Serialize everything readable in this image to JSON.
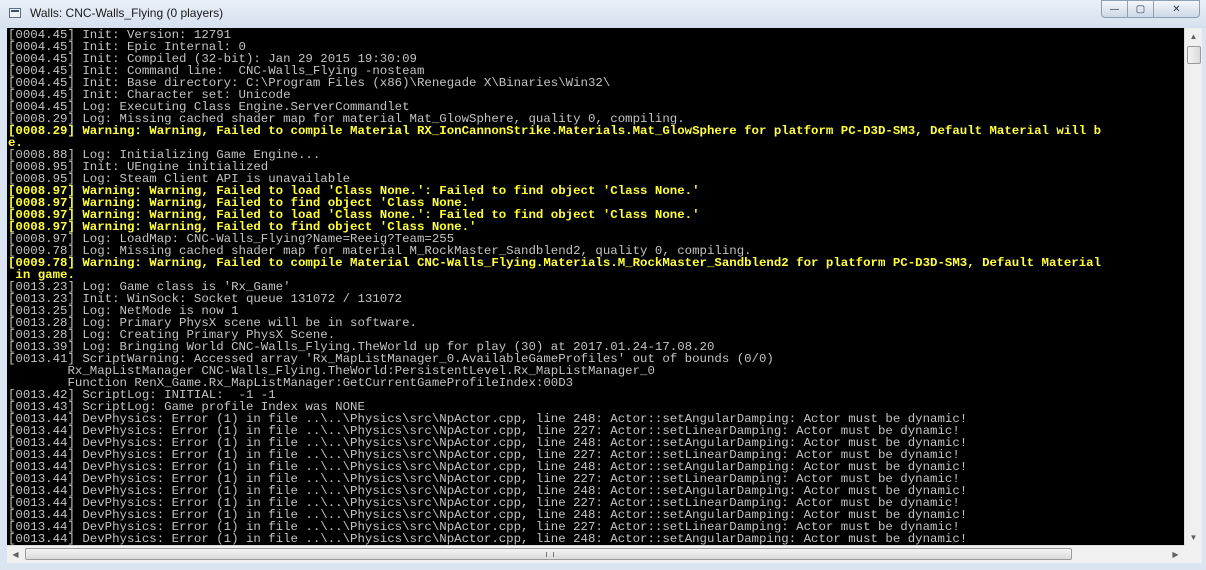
{
  "window": {
    "title": "Walls: CNC-Walls_Flying (0 players)",
    "buttons": {
      "minimize": "—",
      "maximize": "▢",
      "close": "✕"
    }
  },
  "colors": {
    "normal_text": "#c4c4c4",
    "warning_text": "#ffff3c",
    "background": "#000000"
  },
  "console": {
    "lines": [
      {
        "text": "[0004.45] Init: Version: 12791",
        "level": "info"
      },
      {
        "text": "[0004.45] Init: Epic Internal: 0",
        "level": "info"
      },
      {
        "text": "[0004.45] Init: Compiled (32-bit): Jan 29 2015 19:30:09",
        "level": "info"
      },
      {
        "text": "[0004.45] Init: Command line:  CNC-Walls_Flying -nosteam",
        "level": "info"
      },
      {
        "text": "[0004.45] Init: Base directory: C:\\Program Files (x86)\\Renegade X\\Binaries\\Win32\\",
        "level": "info"
      },
      {
        "text": "[0004.45] Init: Character set: Unicode",
        "level": "info"
      },
      {
        "text": "[0004.45] Log: Executing Class Engine.ServerCommandlet",
        "level": "info"
      },
      {
        "text": "[0008.29] Log: Missing cached shader map for material Mat_GlowSphere, quality 0, compiling.",
        "level": "info"
      },
      {
        "text": "[0008.29] Warning: Warning, Failed to compile Material RX_IonCannonStrike.Materials.Mat_GlowSphere for platform PC-D3D-SM3, Default Material will b",
        "level": "warn"
      },
      {
        "text": "e.",
        "level": "warn"
      },
      {
        "text": "[0008.88] Log: Initializing Game Engine...",
        "level": "info"
      },
      {
        "text": "[0008.95] Init: UEngine initialized",
        "level": "info"
      },
      {
        "text": "[0008.95] Log: Steam Client API is unavailable",
        "level": "info"
      },
      {
        "text": "[0008.97] Warning: Warning, Failed to load 'Class None.': Failed to find object 'Class None.'",
        "level": "warn"
      },
      {
        "text": "[0008.97] Warning: Warning, Failed to find object 'Class None.'",
        "level": "warn"
      },
      {
        "text": "[0008.97] Warning: Warning, Failed to load 'Class None.': Failed to find object 'Class None.'",
        "level": "warn"
      },
      {
        "text": "[0008.97] Warning: Warning, Failed to find object 'Class None.'",
        "level": "warn"
      },
      {
        "text": "[0008.97] Log: LoadMap: CNC-Walls_Flying?Name=Reeig?Team=255",
        "level": "info"
      },
      {
        "text": "[0009.78] Log: Missing cached shader map for material M_RockMaster_Sandblend2, quality 0, compiling.",
        "level": "info"
      },
      {
        "text": "[0009.78] Warning: Warning, Failed to compile Material CNC-Walls_Flying.Materials.M_RockMaster_Sandblend2 for platform PC-D3D-SM3, Default Material",
        "level": "warn"
      },
      {
        "text": " in game.",
        "level": "warn"
      },
      {
        "text": "[0013.23] Log: Game class is 'Rx_Game'",
        "level": "info"
      },
      {
        "text": "[0013.23] Init: WinSock: Socket queue 131072 / 131072",
        "level": "info"
      },
      {
        "text": "[0013.25] Log: NetMode is now 1",
        "level": "info"
      },
      {
        "text": "[0013.28] Log: Primary PhysX scene will be in software.",
        "level": "info"
      },
      {
        "text": "[0013.28] Log: Creating Primary PhysX Scene.",
        "level": "info"
      },
      {
        "text": "[0013.39] Log: Bringing World CNC-Walls_Flying.TheWorld up for play (30) at 2017.01.24-17.08.20",
        "level": "info"
      },
      {
        "text": "[0013.41] ScriptWarning: Accessed array 'Rx_MapListManager_0.AvailableGameProfiles' out of bounds (0/0)",
        "level": "info"
      },
      {
        "text": "        Rx_MapListManager CNC-Walls_Flying.TheWorld:PersistentLevel.Rx_MapListManager_0",
        "level": "info"
      },
      {
        "text": "        Function RenX_Game.Rx_MapListManager:GetCurrentGameProfileIndex:00D3",
        "level": "info"
      },
      {
        "text": "[0013.42] ScriptLog: INITIAL:  -1 -1",
        "level": "info"
      },
      {
        "text": "[0013.43] ScriptLog: Game profile Index was NONE",
        "level": "info"
      },
      {
        "text": "[0013.44] DevPhysics: Error (1) in file ..\\..\\Physics\\src\\NpActor.cpp, line 248: Actor::setAngularDamping: Actor must be dynamic!",
        "level": "info"
      },
      {
        "text": "[0013.44] DevPhysics: Error (1) in file ..\\..\\Physics\\src\\NpActor.cpp, line 227: Actor::setLinearDamping: Actor must be dynamic!",
        "level": "info"
      },
      {
        "text": "[0013.44] DevPhysics: Error (1) in file ..\\..\\Physics\\src\\NpActor.cpp, line 248: Actor::setAngularDamping: Actor must be dynamic!",
        "level": "info"
      },
      {
        "text": "[0013.44] DevPhysics: Error (1) in file ..\\..\\Physics\\src\\NpActor.cpp, line 227: Actor::setLinearDamping: Actor must be dynamic!",
        "level": "info"
      },
      {
        "text": "[0013.44] DevPhysics: Error (1) in file ..\\..\\Physics\\src\\NpActor.cpp, line 248: Actor::setAngularDamping: Actor must be dynamic!",
        "level": "info"
      },
      {
        "text": "[0013.44] DevPhysics: Error (1) in file ..\\..\\Physics\\src\\NpActor.cpp, line 227: Actor::setLinearDamping: Actor must be dynamic!",
        "level": "info"
      },
      {
        "text": "[0013.44] DevPhysics: Error (1) in file ..\\..\\Physics\\src\\NpActor.cpp, line 248: Actor::setAngularDamping: Actor must be dynamic!",
        "level": "info"
      },
      {
        "text": "[0013.44] DevPhysics: Error (1) in file ..\\..\\Physics\\src\\NpActor.cpp, line 227: Actor::setLinearDamping: Actor must be dynamic!",
        "level": "info"
      },
      {
        "text": "[0013.44] DevPhysics: Error (1) in file ..\\..\\Physics\\src\\NpActor.cpp, line 248: Actor::setAngularDamping: Actor must be dynamic!",
        "level": "info"
      },
      {
        "text": "[0013.44] DevPhysics: Error (1) in file ..\\..\\Physics\\src\\NpActor.cpp, line 227: Actor::setLinearDamping: Actor must be dynamic!",
        "level": "info"
      },
      {
        "text": "[0013.44] DevPhysics: Error (1) in file ..\\..\\Physics\\src\\NpActor.cpp, line 248: Actor::setAngularDamping: Actor must be dynamic!",
        "level": "info"
      }
    ]
  }
}
